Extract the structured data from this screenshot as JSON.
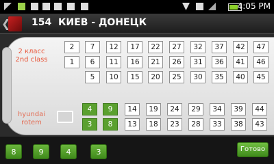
{
  "status": {
    "time": "4:05",
    "time_suffix": "PM",
    "battery_fill": 0.65
  },
  "header": {
    "back_icon": "chevron-left-icon",
    "route_number": "154",
    "route_title": "КИЕВ - ДОНЕЦК"
  },
  "car": {
    "class_label_ru": "2 класс",
    "class_label_en": "2nd class",
    "rows": [
      {
        "seats": [
          "2",
          "7",
          "12",
          "17",
          "22",
          "27",
          "32",
          "37",
          "42",
          "47"
        ]
      },
      {
        "seats": [
          "1",
          "6",
          "11",
          "16",
          "21",
          "26",
          "31",
          "36",
          "41",
          "46"
        ]
      },
      {
        "seats": [
          "5",
          "10",
          "15",
          "20",
          "25",
          "30",
          "35",
          "40",
          "45"
        ]
      },
      {
        "seats": [
          "4",
          "9",
          "14",
          "19",
          "24",
          "29",
          "34",
          "39",
          "44"
        ]
      },
      {
        "seats": [
          "3",
          "8",
          "13",
          "18",
          "23",
          "28",
          "33",
          "38",
          "43"
        ]
      }
    ],
    "selected": [
      "4",
      "9",
      "3",
      "8"
    ],
    "footer_label_1": "hyundai",
    "footer_label_2": "rotem"
  },
  "selection": [
    "8",
    "9",
    "4",
    "3"
  ],
  "done_label": "Готово"
}
